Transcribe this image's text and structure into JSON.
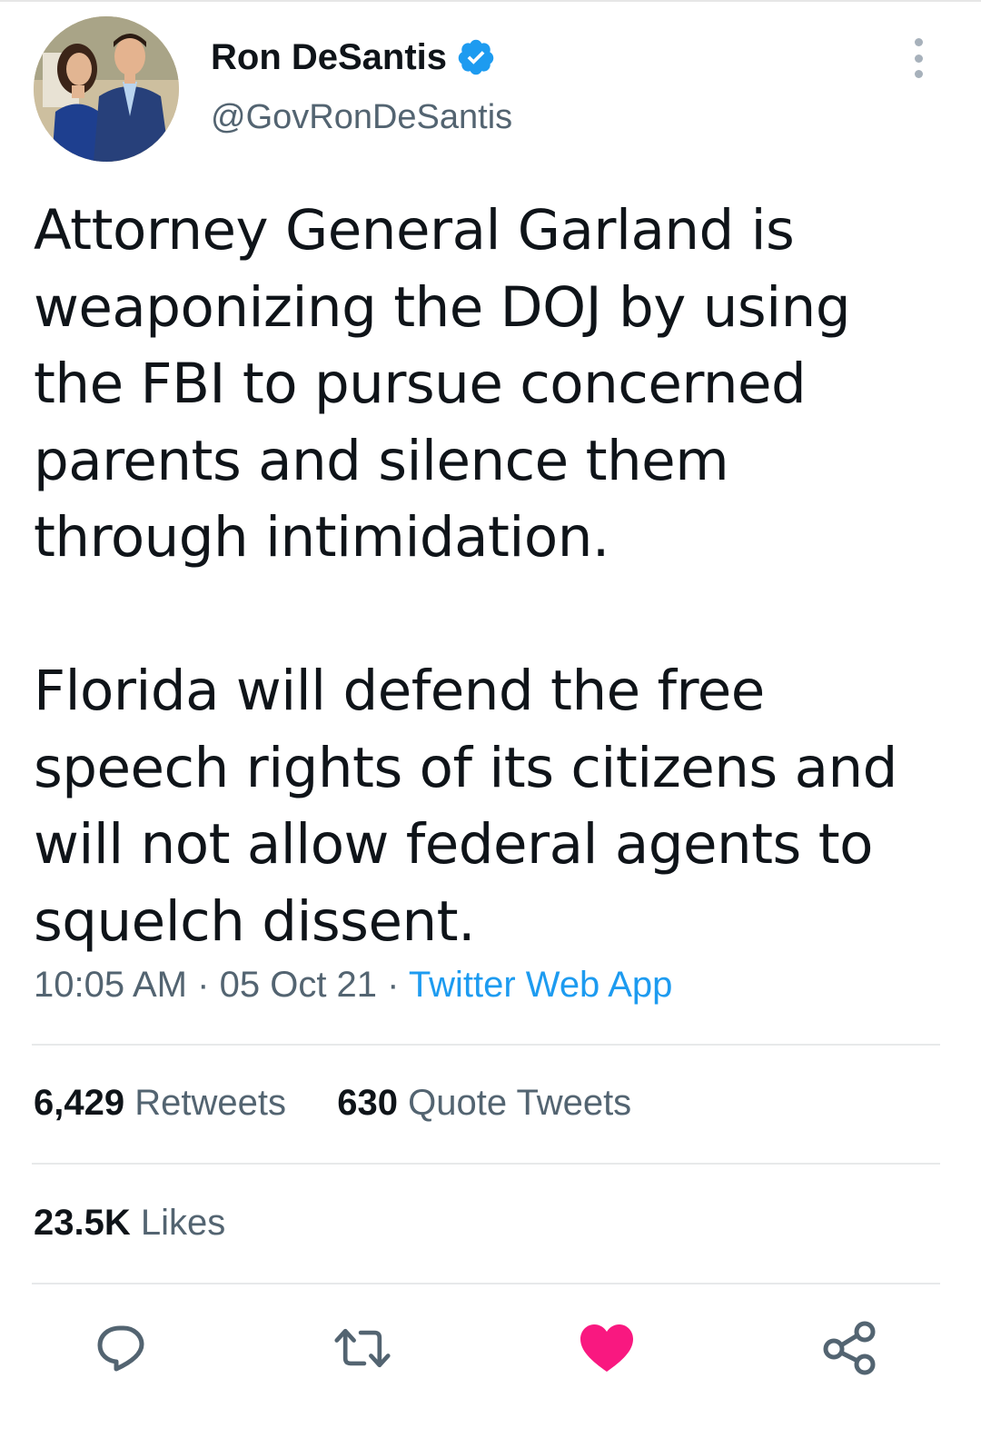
{
  "author": {
    "display_name": "Ron DeSantis",
    "handle": "@GovRonDeSantis",
    "verified": true
  },
  "tweet": {
    "text": "Attorney General Garland is weaponizing the DOJ by using the FBI to pursue concerned parents and silence them through intimidation.\n\nFlorida will defend the free speech rights of its citizens and will not allow federal agents to squelch dissent.",
    "time": "10:05 AM",
    "separator": "·",
    "date": "05 Oct 21",
    "source": "Twitter Web App"
  },
  "stats": {
    "retweets_count": "6,429",
    "retweets_label": "Retweets",
    "quotes_count": "630",
    "quotes_label": "Quote Tweets",
    "likes_count": "23.5K",
    "likes_label": "Likes"
  },
  "actions": {
    "reply_icon": "reply-icon",
    "retweet_icon": "retweet-icon",
    "like_icon": "heart-icon",
    "share_icon": "share-icon"
  },
  "colors": {
    "accent": "#1d9bf0",
    "like": "#f91880",
    "text": "#0f1419",
    "secondary": "#536471"
  }
}
